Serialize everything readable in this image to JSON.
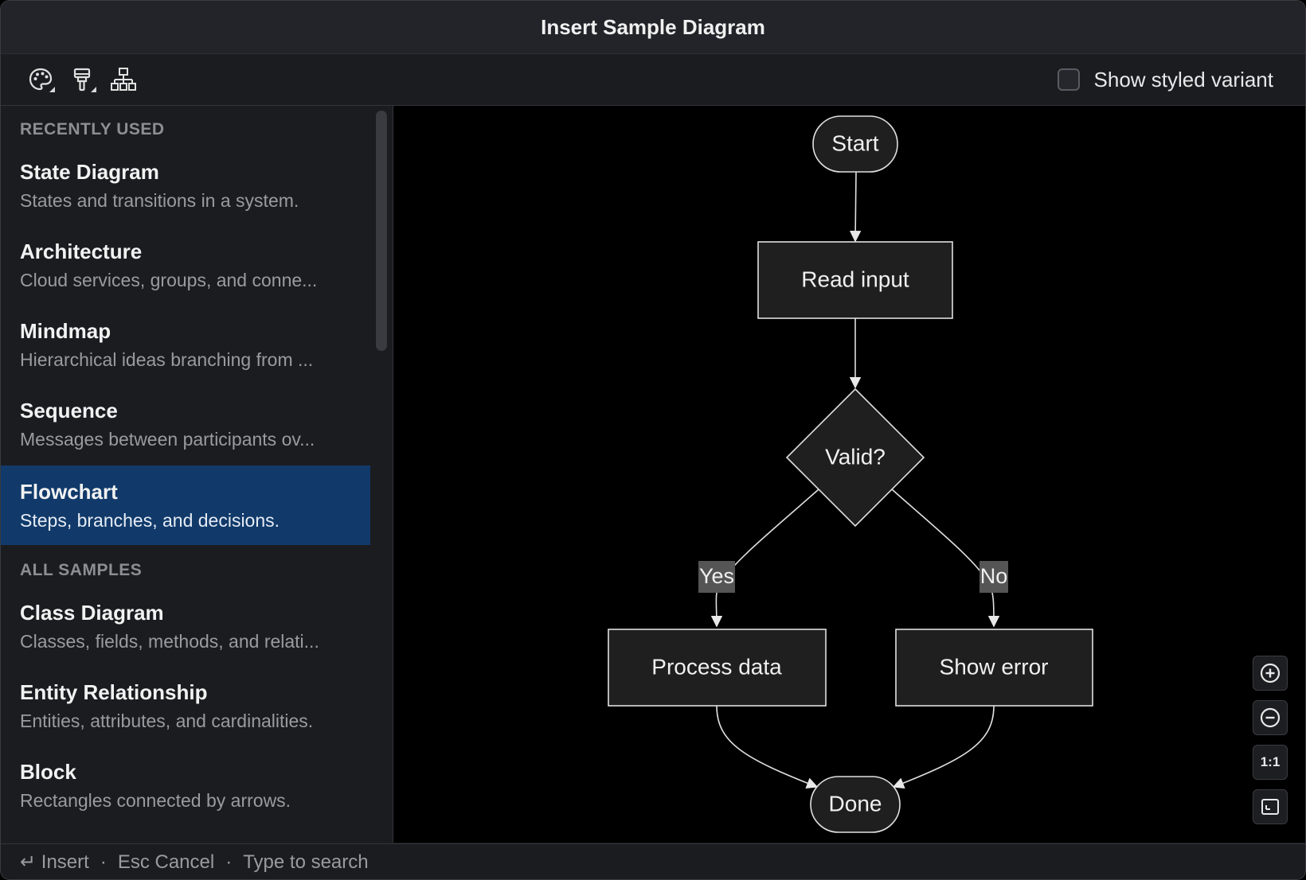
{
  "window": {
    "title": "Insert Sample Diagram"
  },
  "toolbar": {
    "buttons": [
      {
        "name": "theme-palette-button",
        "icon": "palette-icon"
      },
      {
        "name": "style-brush-button",
        "icon": "paint-brush-icon"
      },
      {
        "name": "layout-hierarchy-button",
        "icon": "hierarchy-icon"
      }
    ],
    "styled_variant_label": "Show styled variant",
    "styled_variant_checked": false
  },
  "sidebar": {
    "recent_heading": "RECENTLY USED",
    "recent": [
      {
        "title": "State Diagram",
        "desc": "States and transitions in a system."
      },
      {
        "title": "Architecture",
        "desc": "Cloud services, groups, and conne..."
      },
      {
        "title": "Mindmap",
        "desc": "Hierarchical ideas branching from ..."
      },
      {
        "title": "Sequence",
        "desc": "Messages between participants ov..."
      },
      {
        "title": "Flowchart",
        "desc": "Steps, branches, and decisions."
      }
    ],
    "all_heading": "ALL SAMPLES",
    "all": [
      {
        "title": "Class Diagram",
        "desc": "Classes, fields, methods, and relati..."
      },
      {
        "title": "Entity Relationship",
        "desc": "Entities, attributes, and cardinalities."
      },
      {
        "title": "Block",
        "desc": "Rectangles connected by arrows."
      }
    ],
    "selected": "Flowchart"
  },
  "diagram": {
    "nodes": {
      "start": "Start",
      "read": "Read input",
      "valid": "Valid?",
      "process": "Process data",
      "error": "Show error",
      "done": "Done"
    },
    "edge_labels": {
      "yes": "Yes",
      "no": "No"
    }
  },
  "zoom": {
    "one_to_one": "1:1"
  },
  "statusbar": {
    "insert": "↵ Insert",
    "sep": "·",
    "cancel": "Esc Cancel",
    "search": "Type to search"
  }
}
